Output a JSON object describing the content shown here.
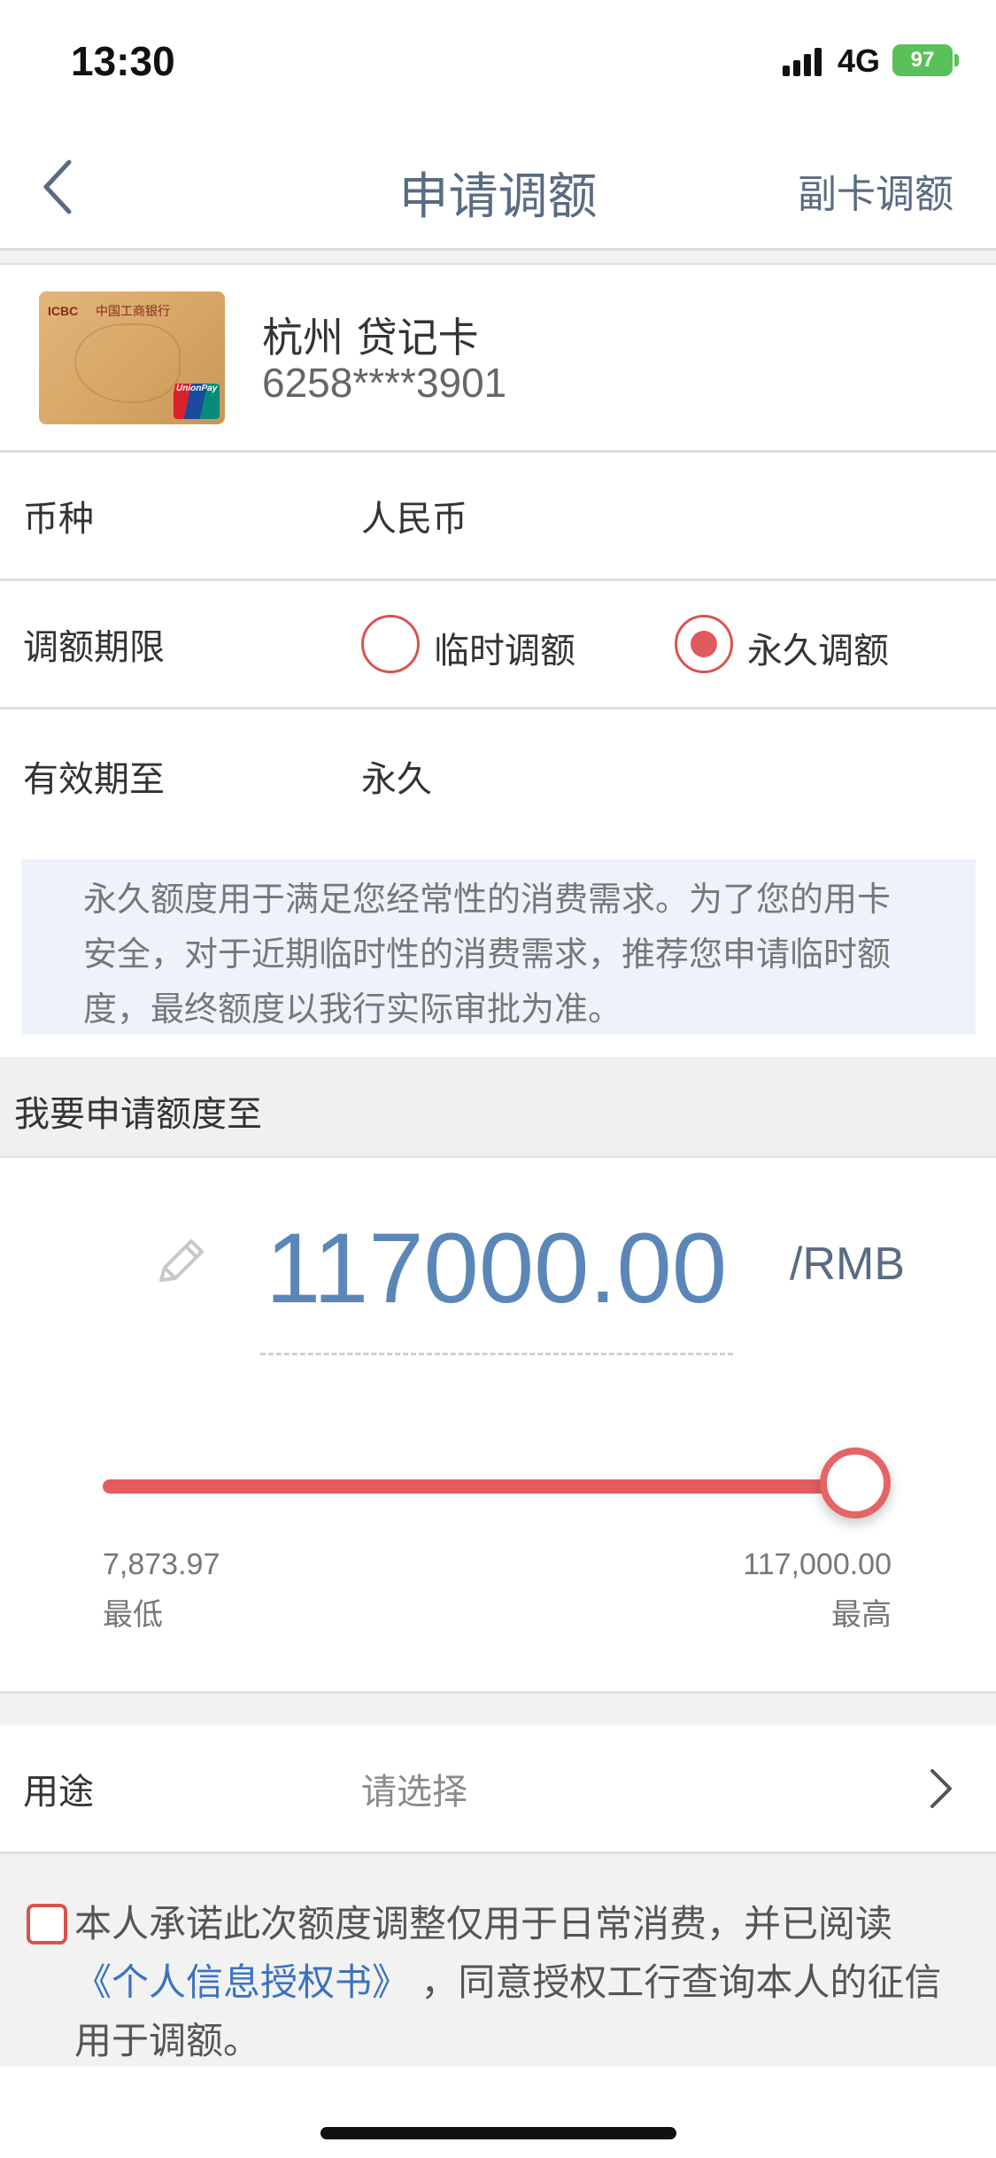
{
  "status_bar": {
    "time": "13:30",
    "network": "4G",
    "battery": "97"
  },
  "nav": {
    "title": "申请调额",
    "right_action": "副卡调额"
  },
  "card": {
    "name": "杭州  贷记卡",
    "number": "6258****3901",
    "image_brand": "ICBC",
    "image_brand_cn": "中国工商银行",
    "image_logo": "UnionPay"
  },
  "rows": {
    "currency": {
      "label": "币种",
      "value": "人民币"
    },
    "period": {
      "label": "调额期限",
      "options": [
        {
          "label": "临时调额",
          "selected": false
        },
        {
          "label": "永久调额",
          "selected": true
        }
      ]
    },
    "valid_until": {
      "label": "有效期至",
      "value": "永久"
    }
  },
  "notice": "永久额度用于满足您经常性的消费需求。为了您的用卡安全，对于近期临时性的消费需求，推荐您申请临时额度，最终额度以我行实际审批为准。",
  "section_header": "我要申请额度至",
  "amount": {
    "value": "117000.00",
    "unit": "/RMB",
    "slider": {
      "min_value": "7,873.97",
      "min_label": "最低",
      "max_value": "117,000.00",
      "max_label": "最高",
      "fill_fraction": 1.0
    }
  },
  "purpose": {
    "label": "用途",
    "placeholder": "请选择"
  },
  "agreement": {
    "text_before": "本人承诺此次额度调整仅用于日常消费，并已阅读",
    "link": "《个人信息授权书》",
    "text_after": "，同意授权工行查询本人的征信用于调额。"
  },
  "colors": {
    "accent": "#e35d5f",
    "amount_blue": "#5b87b8",
    "nav_text": "#5a6b82",
    "link_blue": "#3a72c2",
    "battery_green": "#5ac05a"
  }
}
